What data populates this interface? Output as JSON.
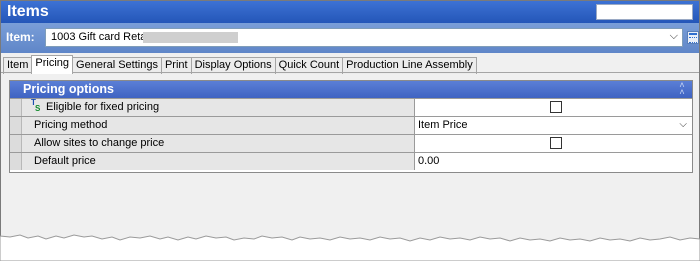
{
  "window": {
    "title": "Items"
  },
  "item_bar": {
    "label": "Item:",
    "value": "1003 Gift card Retail"
  },
  "tabs": [
    {
      "label": "Item"
    },
    {
      "label": "Pricing"
    },
    {
      "label": "General Settings"
    },
    {
      "label": "Print"
    },
    {
      "label": "Display Options"
    },
    {
      "label": "Quick Count"
    },
    {
      "label": "Production Line Assembly"
    }
  ],
  "active_tab": "Pricing",
  "section": {
    "title": "Pricing options",
    "rows": [
      {
        "label": "Eligible for fixed pricing",
        "type": "checkbox",
        "checked": false
      },
      {
        "label": "Pricing method",
        "type": "dropdown",
        "value": "Item Price"
      },
      {
        "label": "Allow sites to change price",
        "type": "checkbox",
        "checked": false
      },
      {
        "label": "Default price",
        "type": "text",
        "value": "0.00"
      }
    ]
  },
  "colors": {
    "title_bar": "#2f62c4",
    "item_bar": "#6e93d2",
    "section_header": "#4a6ecb"
  }
}
